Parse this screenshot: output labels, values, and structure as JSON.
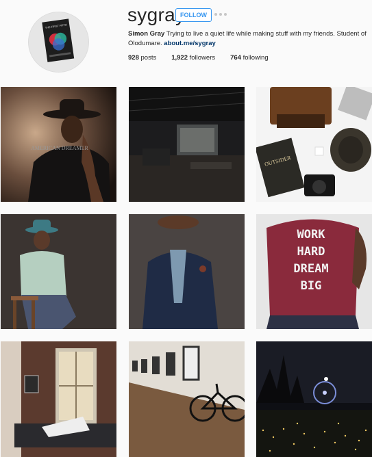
{
  "profile": {
    "username": "sygray",
    "follow_label": "FOLLOW",
    "fullname": "Simon Gray",
    "bio_text": "Trying to live a quiet life while making stuff with my friends. Student of Olodumare.",
    "link": "about.me/sygray",
    "stats": {
      "posts_count": "928",
      "posts_label": "posts",
      "followers_count": "1,922",
      "followers_label": "followers",
      "following_count": "764",
      "following_label": "following"
    },
    "avatar_book_title": "THE FIRST FIFTH"
  },
  "posts": [
    {
      "name": "post-man-in-hat-american-dream",
      "shirt_text": "AMERICAN DREAMER"
    },
    {
      "name": "post-dark-industrial-interior"
    },
    {
      "name": "post-flatlay-books-camera-hat",
      "book_text": "OUTSIDER"
    },
    {
      "name": "post-man-seated-teal-hat"
    },
    {
      "name": "post-man-suit-brown-hat"
    },
    {
      "name": "post-work-hard-dream-big-shirt",
      "shirt_lines": [
        "WORK",
        "HARD",
        "DREAM",
        "BIG"
      ]
    },
    {
      "name": "post-loft-window-reclining"
    },
    {
      "name": "post-gallery-hallway-bicycle"
    },
    {
      "name": "post-night-park-ferris-wheel"
    }
  ],
  "colors": {
    "accent": "#3897f0",
    "link": "#003569",
    "text": "#262626",
    "muted": "#c7c7c7"
  },
  "icons": {
    "more": "more-dots-icon"
  }
}
